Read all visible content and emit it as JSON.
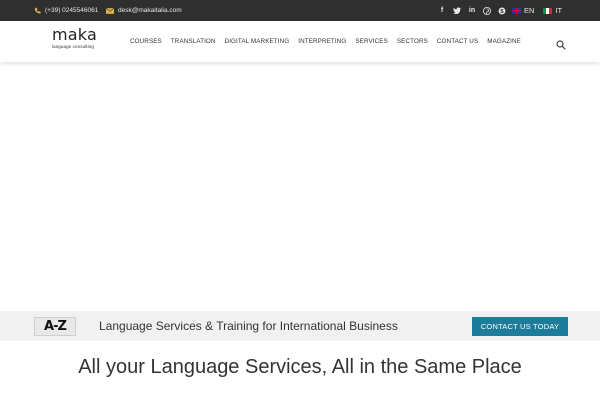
{
  "topbar": {
    "phone": "(+39) 0245546061",
    "email": "desk@makaitalia.com",
    "phone_icon": "phone-icon",
    "email_icon": "envelope-icon",
    "accent_color": "#e2b64a",
    "social": [
      {
        "icon": "facebook-icon",
        "glyph": "f"
      },
      {
        "icon": "twitter-icon",
        "glyph": ""
      },
      {
        "icon": "linkedin-icon",
        "glyph": "in"
      },
      {
        "icon": "pinterest-icon",
        "glyph": "P"
      },
      {
        "icon": "skype-icon",
        "glyph": "S"
      }
    ],
    "languages": [
      {
        "code": "EN",
        "flag": "uk-flag-icon"
      },
      {
        "code": "IT",
        "flag": "italy-flag-icon"
      }
    ]
  },
  "header": {
    "logo_text": "maka",
    "logo_subtitle": "language consulting",
    "nav": [
      "COURSES",
      "TRANSLATION",
      "DIGITAL MARKETING",
      "INTERPRETING",
      "SERVICES",
      "SECTORS",
      "CONTACT US",
      "MAGAZINE"
    ],
    "search_icon": "search-icon"
  },
  "band": {
    "logo_text": "A-Z",
    "tagline": "Language Services & Training for International Business",
    "cta_label": "CONTACT US TODAY",
    "cta_color": "#1d7c9a"
  },
  "main": {
    "headline": "All your Language Services, All in the Same Place"
  }
}
